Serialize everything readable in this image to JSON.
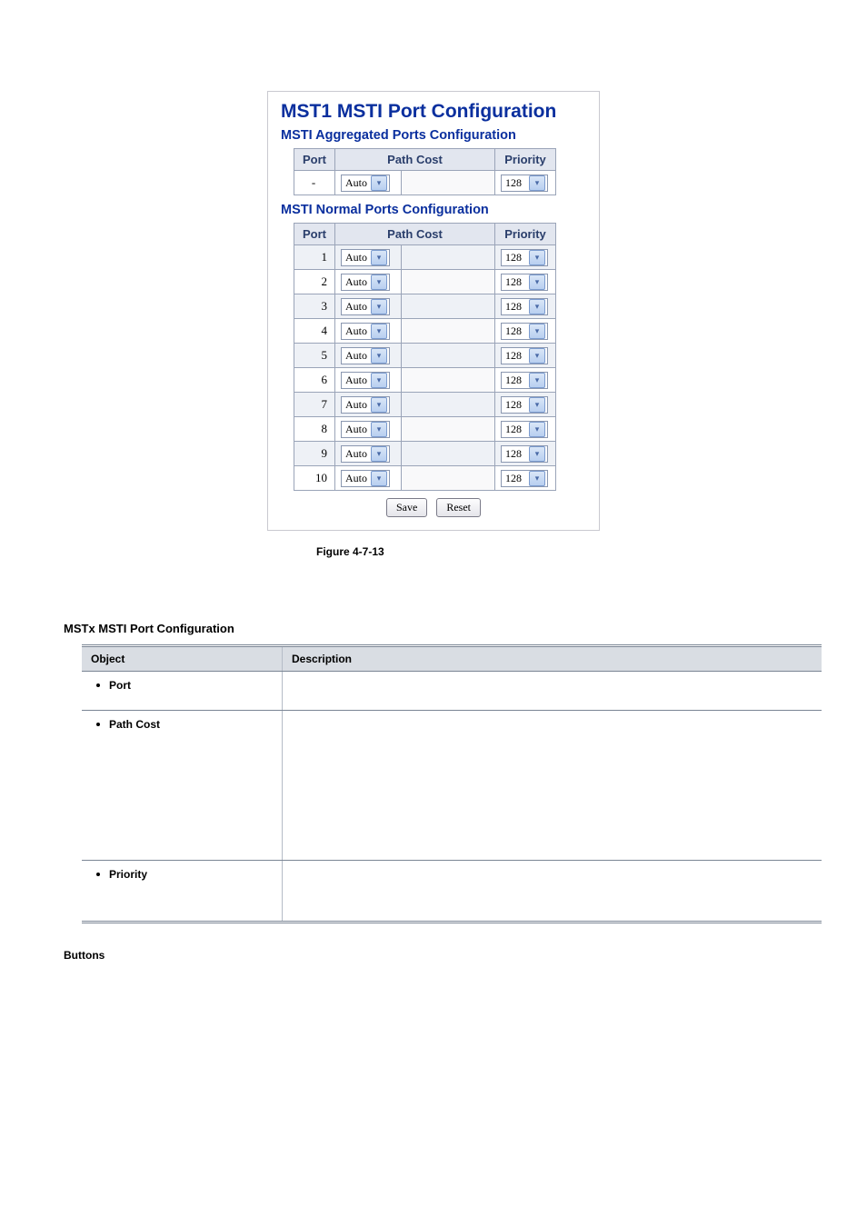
{
  "panel": {
    "title": "MST1 MSTI Port Configuration",
    "agg_heading": "MSTI Aggregated Ports Configuration",
    "normal_heading": "MSTI Normal Ports Configuration",
    "headers": {
      "port": "Port",
      "path_cost": "Path Cost",
      "priority": "Priority"
    },
    "agg_row": {
      "port": "-",
      "mode": "Auto",
      "value": "",
      "priority": "128"
    },
    "rows": [
      {
        "port": "1",
        "mode": "Auto",
        "value": "",
        "priority": "128"
      },
      {
        "port": "2",
        "mode": "Auto",
        "value": "",
        "priority": "128"
      },
      {
        "port": "3",
        "mode": "Auto",
        "value": "",
        "priority": "128"
      },
      {
        "port": "4",
        "mode": "Auto",
        "value": "",
        "priority": "128"
      },
      {
        "port": "5",
        "mode": "Auto",
        "value": "",
        "priority": "128"
      },
      {
        "port": "6",
        "mode": "Auto",
        "value": "",
        "priority": "128"
      },
      {
        "port": "7",
        "mode": "Auto",
        "value": "",
        "priority": "128"
      },
      {
        "port": "8",
        "mode": "Auto",
        "value": "",
        "priority": "128"
      },
      {
        "port": "9",
        "mode": "Auto",
        "value": "",
        "priority": "128"
      },
      {
        "port": "10",
        "mode": "Auto",
        "value": "",
        "priority": "128"
      }
    ],
    "buttons": {
      "save": "Save",
      "reset": "Reset"
    }
  },
  "caption": "Figure 4-7-13",
  "section_heading": "MSTx MSTI Port Configuration",
  "desc_table": {
    "headers": {
      "object": "Object",
      "description": "Description"
    },
    "rows": [
      {
        "object": "Port",
        "description": ""
      },
      {
        "object": "Path Cost",
        "description": ""
      },
      {
        "object": "Priority",
        "description": ""
      }
    ]
  },
  "buttons_heading": "Buttons"
}
